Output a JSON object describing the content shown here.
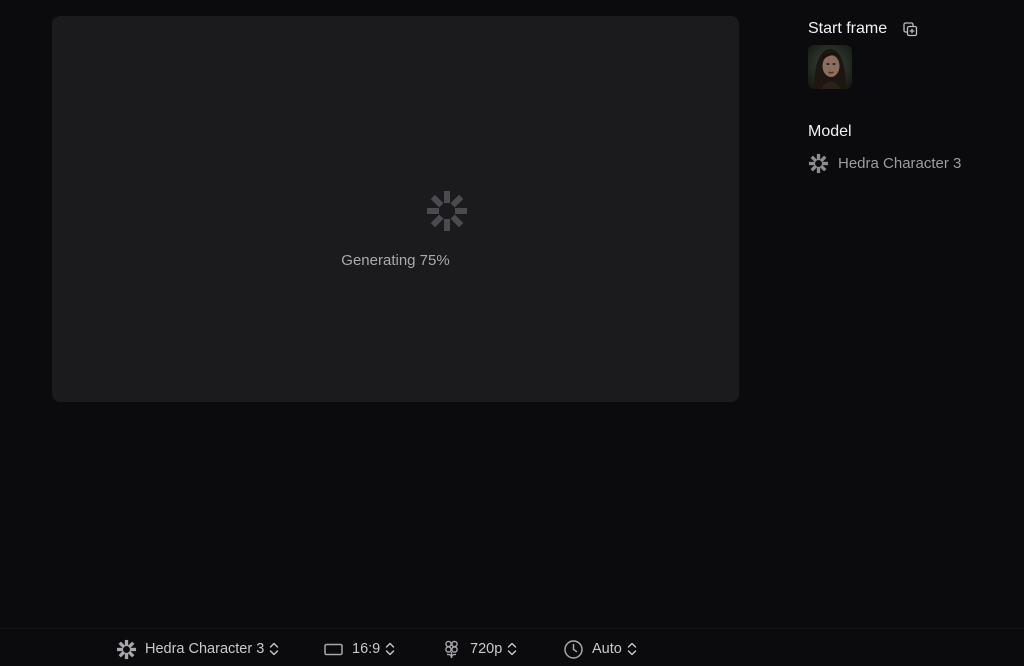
{
  "preview": {
    "status_text": "Generating 75%",
    "progress_percent": 75,
    "spinner_icon": "hedra-logo-icon"
  },
  "sidebar": {
    "start_frame_title": "Start frame",
    "start_frame_action_icon": "add-copy-icon",
    "start_frame_thumbnail": "portrait-thumbnail",
    "model_title": "Model",
    "model_name": "Hedra Character 3",
    "model_icon": "hedra-logo-icon"
  },
  "toolbar": {
    "model": {
      "label": "Hedra Character 3",
      "icon": "hedra-logo-icon"
    },
    "aspect_ratio": {
      "label": "16:9",
      "icon": "aspect-ratio-icon"
    },
    "resolution": {
      "label": "720p",
      "icon": "resolution-icon"
    },
    "duration": {
      "label": "Auto",
      "icon": "clock-icon"
    }
  },
  "colors": {
    "background": "#0b0b0d",
    "panel": "#1b1b1e",
    "text_primary": "#f2f2f4",
    "text_secondary": "#9c9ca2",
    "spinner": "#4a4a4f"
  }
}
